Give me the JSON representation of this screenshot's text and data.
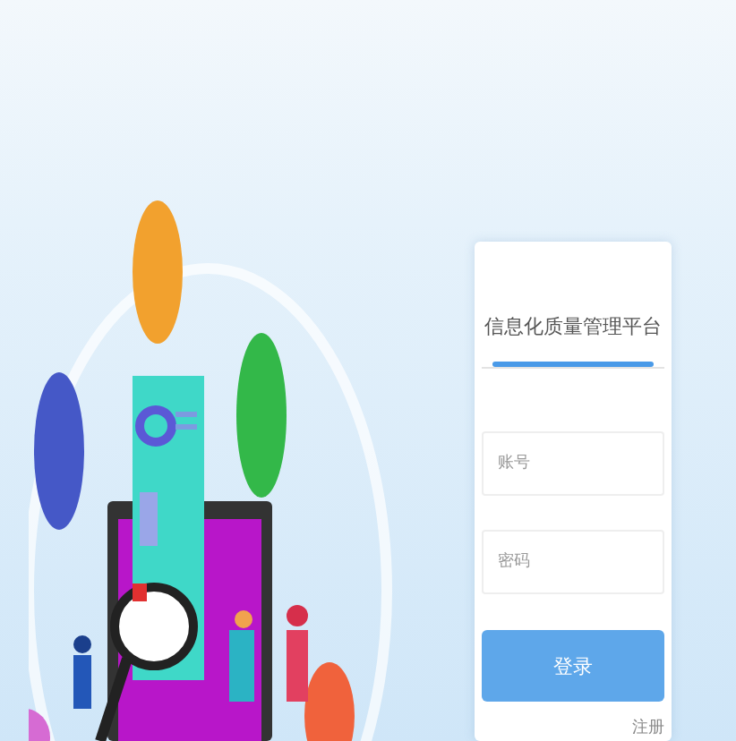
{
  "login_card": {
    "title": "信息化质量管理平台",
    "fields": [
      {
        "placeholder": "账号"
      },
      {
        "placeholder": "密码"
      }
    ],
    "submit_button": "登录",
    "link": "注册"
  }
}
